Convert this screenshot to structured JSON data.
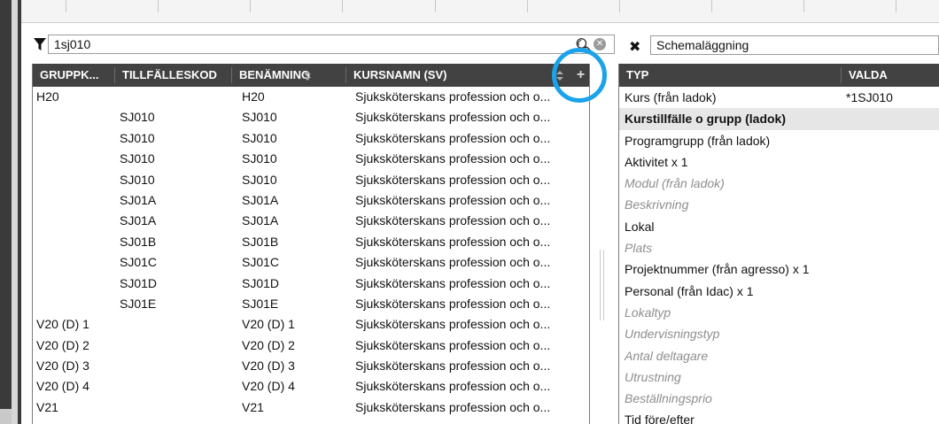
{
  "filter": {
    "query": "1sj010"
  },
  "left_grid": {
    "columns": [
      "GRUPPK...",
      "TILLFÄLLESKOD",
      "BENÄMNING",
      "KURSNAMN (SV)"
    ],
    "add_label": "+",
    "rows": [
      [
        "H20",
        "",
        "H20",
        "Sjuksköterskans profession och o..."
      ],
      [
        "",
        "SJ010",
        "SJ010",
        "Sjuksköterskans profession och o..."
      ],
      [
        "",
        "SJ010",
        "SJ010",
        "Sjuksköterskans profession och o..."
      ],
      [
        "",
        "SJ010",
        "SJ010",
        "Sjuksköterskans profession och o..."
      ],
      [
        "",
        "SJ010",
        "SJ010",
        "Sjuksköterskans profession och o..."
      ],
      [
        "",
        "SJ01A",
        "SJ01A",
        "Sjuksköterskans profession och o..."
      ],
      [
        "",
        "SJ01A",
        "SJ01A",
        "Sjuksköterskans profession och o..."
      ],
      [
        "",
        "SJ01B",
        "SJ01B",
        "Sjuksköterskans profession och o..."
      ],
      [
        "",
        "SJ01C",
        "SJ01C",
        "Sjuksköterskans profession och o..."
      ],
      [
        "",
        "SJ01D",
        "SJ01D",
        "Sjuksköterskans profession och o..."
      ],
      [
        "",
        "SJ01E",
        "SJ01E",
        "Sjuksköterskans profession och o..."
      ],
      [
        "V20 (D) 1",
        "",
        "V20 (D) 1",
        "Sjuksköterskans profession och o..."
      ],
      [
        "V20 (D) 2",
        "",
        "V20 (D) 2",
        "Sjuksköterskans profession och o..."
      ],
      [
        "V20 (D) 3",
        "",
        "V20 (D) 3",
        "Sjuksköterskans profession och o..."
      ],
      [
        "V20 (D) 4",
        "",
        "V20 (D) 4",
        "Sjuksköterskans profession och o..."
      ],
      [
        "V21",
        "",
        "V21",
        "Sjuksköterskans profession och o..."
      ]
    ]
  },
  "right_panel": {
    "title_value": "Schemaläggning",
    "columns": [
      "TYP",
      "VALDA"
    ],
    "rows": [
      {
        "type": "Kurs (från ladok)",
        "value": "*1SJ010",
        "state": "normal"
      },
      {
        "type": "Kurstillfälle o grupp (ladok)",
        "value": "",
        "state": "selected"
      },
      {
        "type": "Programgrupp (från ladok)",
        "value": "",
        "state": "normal"
      },
      {
        "type": "Aktivitet x 1",
        "value": "",
        "state": "normal"
      },
      {
        "type": "Modul (från ladok)",
        "value": "",
        "state": "dim"
      },
      {
        "type": "Beskrivning",
        "value": "",
        "state": "dim"
      },
      {
        "type": "Lokal",
        "value": "",
        "state": "normal"
      },
      {
        "type": "Plats",
        "value": "",
        "state": "dim"
      },
      {
        "type": "Projektnummer (från agresso) x 1",
        "value": "",
        "state": "normal"
      },
      {
        "type": "Personal (från Idac) x 1",
        "value": "",
        "state": "normal"
      },
      {
        "type": "Lokaltyp",
        "value": "",
        "state": "dim"
      },
      {
        "type": "Undervisningstyp",
        "value": "",
        "state": "dim"
      },
      {
        "type": "Antal deltagare",
        "value": "",
        "state": "dim"
      },
      {
        "type": "Utrustning",
        "value": "",
        "state": "dim"
      },
      {
        "type": "Beställningsprio",
        "value": "",
        "state": "dim"
      },
      {
        "type": "Tid före/efter",
        "value": "",
        "state": "normal"
      }
    ]
  },
  "colors": {
    "header_bg": "#424242",
    "highlight_ring": "#1aa3ea",
    "selected_row": "#e6e6e6"
  }
}
